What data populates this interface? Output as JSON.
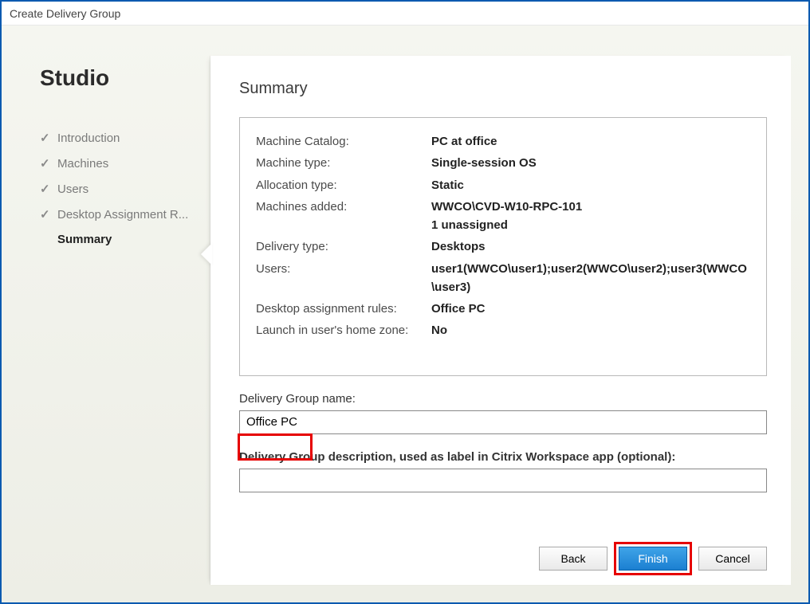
{
  "window": {
    "title": "Create Delivery Group"
  },
  "sidebar": {
    "app_title": "Studio",
    "items": [
      {
        "label": "Introduction",
        "done": true,
        "current": false
      },
      {
        "label": "Machines",
        "done": true,
        "current": false
      },
      {
        "label": "Users",
        "done": true,
        "current": false
      },
      {
        "label": "Desktop Assignment R...",
        "done": true,
        "current": false
      },
      {
        "label": "Summary",
        "done": false,
        "current": true
      }
    ]
  },
  "page": {
    "heading": "Summary",
    "summary": [
      {
        "label": "Machine Catalog:",
        "value": "PC at office"
      },
      {
        "label": "Machine type:",
        "value": "Single-session OS"
      },
      {
        "label": "Allocation type:",
        "value": "Static"
      },
      {
        "label": "Machines added:",
        "value": "WWCO\\CVD-W10-RPC-101\n1 unassigned"
      },
      {
        "label": "Delivery type:",
        "value": "Desktops"
      },
      {
        "label": "Users:",
        "value": "user1(WWCO\\user1);user2(WWCO\\user2);user3(WWCO\\user3)"
      },
      {
        "label": "Desktop assignment rules:",
        "value": "Office PC"
      },
      {
        "label": "Launch in user's home zone:",
        "value": "No"
      }
    ],
    "name_label": "Delivery Group name:",
    "name_value": "Office PC",
    "desc_label": "Delivery Group description, used as label in Citrix Workspace app (optional):",
    "desc_value": ""
  },
  "buttons": {
    "back": "Back",
    "finish": "Finish",
    "cancel": "Cancel"
  }
}
